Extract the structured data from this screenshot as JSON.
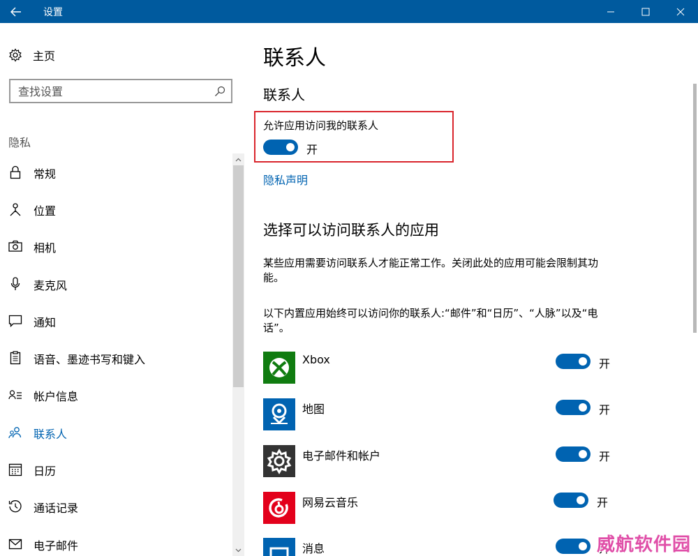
{
  "window": {
    "title": "设置"
  },
  "sidebar": {
    "home_label": "主页",
    "search_placeholder": "查找设置",
    "section_label": "隐私",
    "items": [
      {
        "label": "常规",
        "icon": "lock-icon",
        "active": false
      },
      {
        "label": "位置",
        "icon": "location-icon",
        "active": false
      },
      {
        "label": "相机",
        "icon": "camera-icon",
        "active": false
      },
      {
        "label": "麦克风",
        "icon": "microphone-icon",
        "active": false
      },
      {
        "label": "通知",
        "icon": "notification-icon",
        "active": false
      },
      {
        "label": "语音、墨迹书写和键入",
        "icon": "clipboard-icon",
        "active": false
      },
      {
        "label": "帐户信息",
        "icon": "account-info-icon",
        "active": false
      },
      {
        "label": "联系人",
        "icon": "contacts-icon",
        "active": true
      },
      {
        "label": "日历",
        "icon": "calendar-icon",
        "active": false
      },
      {
        "label": "通话记录",
        "icon": "call-history-icon",
        "active": false
      },
      {
        "label": "电子邮件",
        "icon": "mail-icon",
        "active": false
      }
    ]
  },
  "main": {
    "page_title": "联系人",
    "section_title": "联系人",
    "permission_label": "允许应用访问我的联系人",
    "permission_state": "开",
    "privacy_link": "隐私声明",
    "apps_title": "选择可以访问联系人的应用",
    "desc1": "某些应用需要访问联系人才能正常工作。关闭此处的应用可能会限制其功能。",
    "desc2": "以下内置应用始终可以访问你的联系人:“邮件”和“日历”、“人脉”以及“电话”。",
    "apps": [
      {
        "name": "Xbox",
        "state": "开",
        "icon": "xbox-icon",
        "color": "#107c10"
      },
      {
        "name": "地图",
        "state": "开",
        "icon": "maps-icon",
        "color": "#0063b1"
      },
      {
        "name": "电子邮件和帐户",
        "state": "开",
        "icon": "gear-icon",
        "color": "#333333"
      },
      {
        "name": "网易云音乐",
        "state": "开",
        "icon": "netease-music-icon",
        "color": "#e3001b"
      },
      {
        "name": "消息",
        "state": "开",
        "icon": "messaging-icon",
        "color": "#0063b1"
      }
    ]
  },
  "colors": {
    "titlebar": "#005a9e",
    "accent": "#0063b1",
    "highlight_border": "#d9242b"
  },
  "watermark": "威航软件园"
}
